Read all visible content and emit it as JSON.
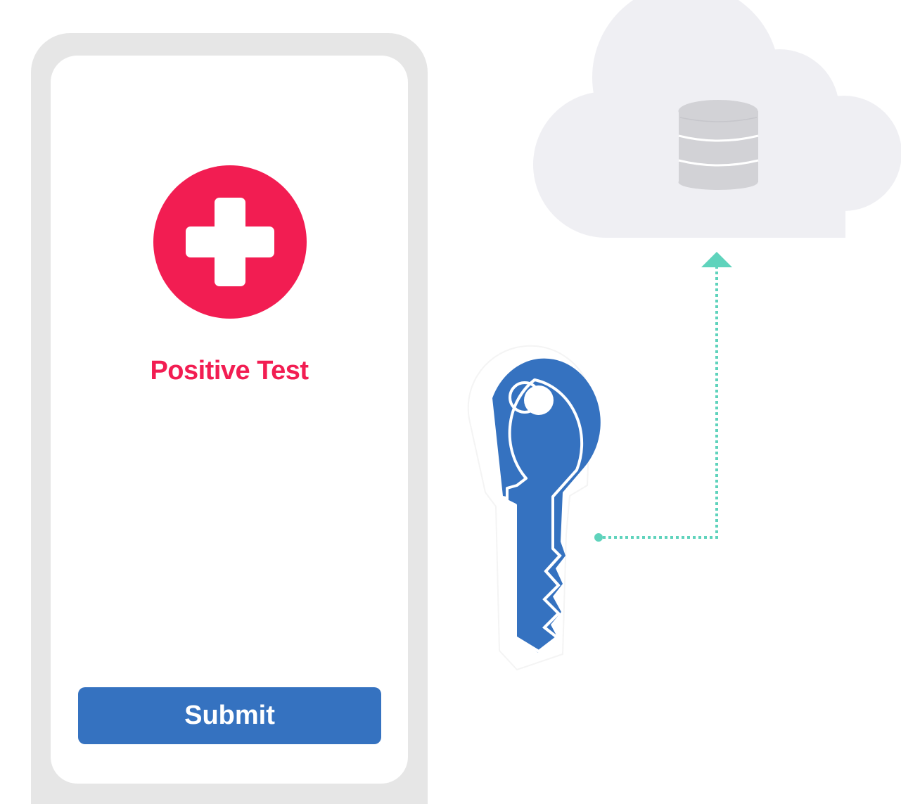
{
  "phone": {
    "status_label": "Positive Test",
    "submit_label": "Submit"
  },
  "icons": {
    "status": "plus-circle-icon",
    "key": "key-icon",
    "cloud": "cloud-icon",
    "database": "database-icon",
    "upload_arrow": "upload-arrow"
  },
  "colors": {
    "status_red": "#f21d52",
    "button_blue": "#3572c0",
    "key_blue": "#3572c0",
    "arrow_teal": "#5fd3bc",
    "cloud_gray": "#efeff3",
    "database_gray": "#d2d2d6",
    "frame_gray": "#e6e6e6"
  }
}
